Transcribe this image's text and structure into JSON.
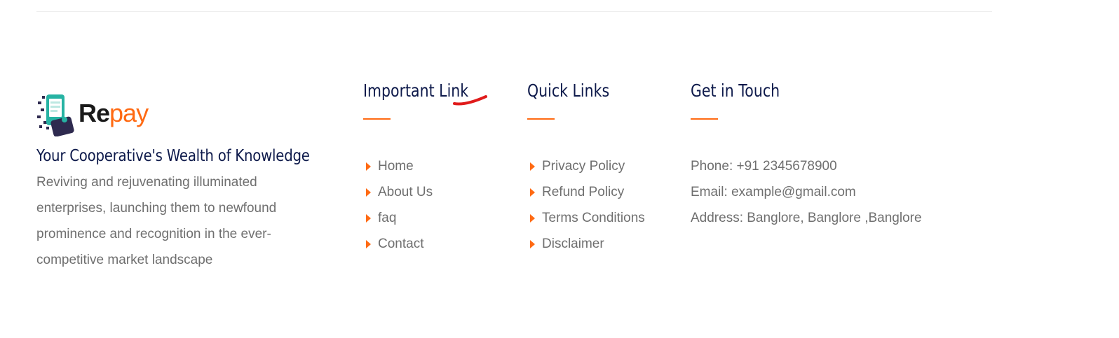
{
  "brand": {
    "name_part1": "Re",
    "name_part2": "pay",
    "accent_color": "#ff6a13",
    "heading_color": "#0e1a4b"
  },
  "about": {
    "tagline": "Your Cooperative's Wealth of Knowledge",
    "description": "Reviving and rejuvenating illuminated enterprises, launching them to newfound prominence and recognition in the ever-competitive market landscape"
  },
  "important_links": {
    "title": "Important Link",
    "items": [
      {
        "label": "Home"
      },
      {
        "label": "About Us"
      },
      {
        "label": "faq"
      },
      {
        "label": "Contact"
      }
    ]
  },
  "quick_links": {
    "title": "Quick Links",
    "items": [
      {
        "label": "Privacy Policy"
      },
      {
        "label": "Refund Policy"
      },
      {
        "label": "Terms Conditions"
      },
      {
        "label": "Disclaimer"
      }
    ]
  },
  "contact": {
    "title": "Get in Touch",
    "phone": "Phone: +91 2345678900",
    "email": "Email: example@gmail.com",
    "address": "Address: Banglore, Banglore ,Banglore"
  }
}
